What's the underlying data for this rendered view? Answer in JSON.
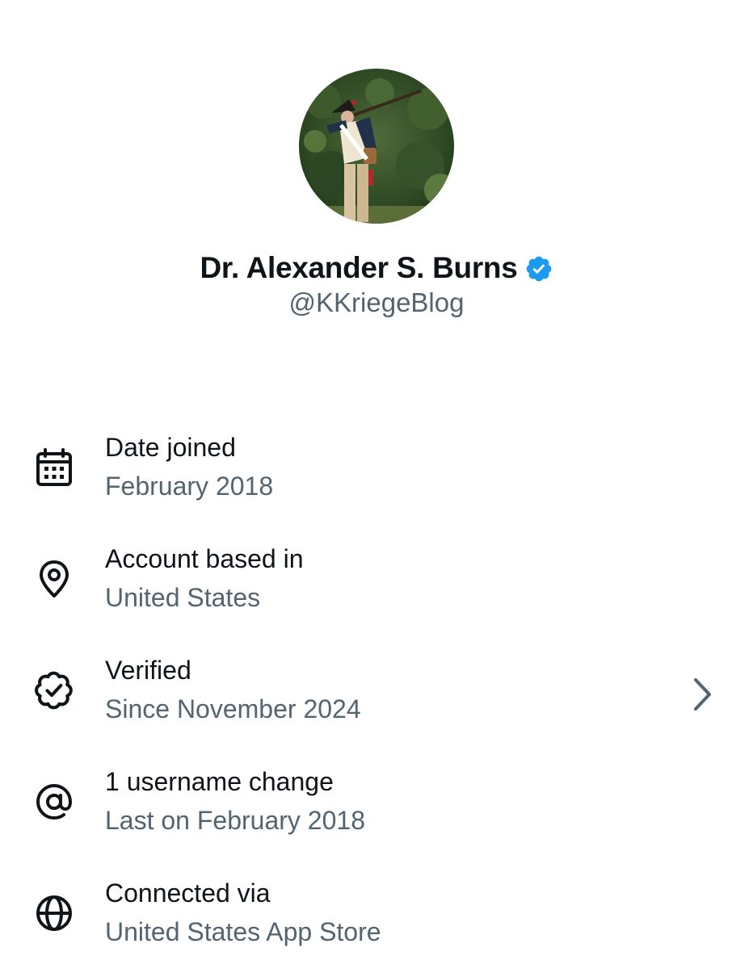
{
  "profile": {
    "display_name": "Dr. Alexander S. Burns",
    "handle": "@KKriegeBlog",
    "verified": true,
    "verified_badge_color": "#1d9bf0",
    "avatar_icon": "avatar-photo"
  },
  "about": {
    "items": [
      {
        "icon": "calendar-icon",
        "title": "Date joined",
        "subtitle": "February 2018",
        "has_chevron": false
      },
      {
        "icon": "location-pin-icon",
        "title": "Account based in",
        "subtitle": "United States",
        "has_chevron": false
      },
      {
        "icon": "verified-badge-outline-icon",
        "title": "Verified",
        "subtitle": "Since November 2024",
        "has_chevron": true
      },
      {
        "icon": "at-sign-icon",
        "title": "1 username change",
        "subtitle": "Last on February 2018",
        "has_chevron": false
      },
      {
        "icon": "globe-icon",
        "title": "Connected via",
        "subtitle": "United States App Store",
        "has_chevron": false
      }
    ]
  },
  "colors": {
    "primary_text": "#0f1419",
    "secondary_text": "#536471",
    "accent": "#1d9bf0",
    "background": "#ffffff"
  }
}
